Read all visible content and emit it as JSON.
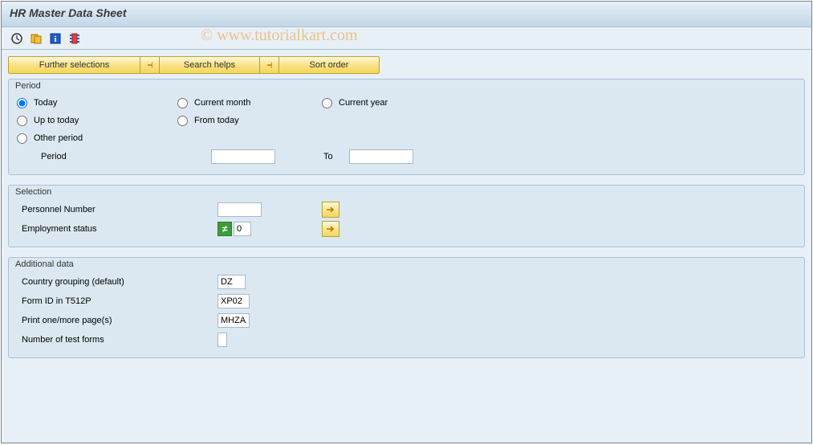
{
  "header": {
    "title": "HR Master Data Sheet"
  },
  "watermark": "© www.tutorialkart.com",
  "buttons": {
    "further_selections": "Further selections",
    "search_helps": "Search helps",
    "sort_order": "Sort order"
  },
  "period": {
    "title": "Period",
    "options": {
      "today": "Today",
      "current_month": "Current month",
      "current_year": "Current year",
      "up_to_today": "Up to today",
      "from_today": "From today",
      "other_period": "Other period"
    },
    "selected": "today",
    "period_label": "Period",
    "to_label": "To",
    "period_from": "",
    "period_to": ""
  },
  "selection": {
    "title": "Selection",
    "personnel_number_label": "Personnel Number",
    "personnel_number_value": "",
    "employment_status_label": "Employment status",
    "employment_status_value": "0",
    "employment_status_operator": "≠"
  },
  "additional": {
    "title": "Additional data",
    "country_grouping_label": "Country grouping (default)",
    "country_grouping_value": "DZ",
    "form_id_label": "Form ID in T512P",
    "form_id_value": "XP02",
    "print_pages_label": "Print one/more page(s)",
    "print_pages_value": "MHZA",
    "test_forms_label": "Number of test forms",
    "test_forms_value": ""
  }
}
